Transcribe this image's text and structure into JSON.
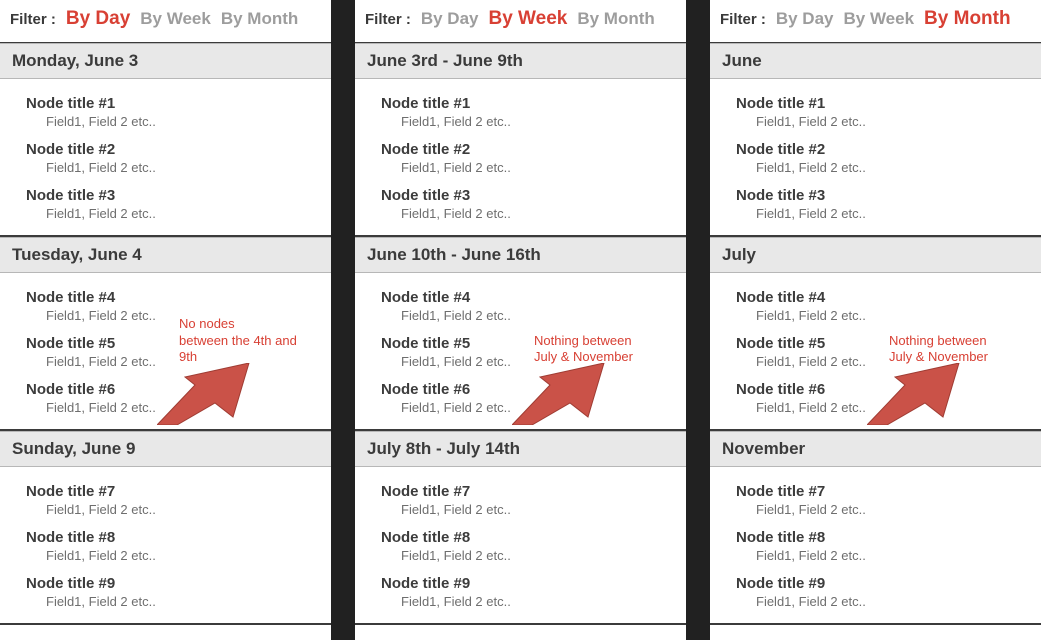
{
  "colors": {
    "accent": "#d84034",
    "header_bg": "#e8e8e8"
  },
  "filter_label": "Filter :",
  "filter_options": [
    "By Day",
    "By Week",
    "By Month"
  ],
  "panels": [
    {
      "active_filter": 0,
      "sections": [
        {
          "header": "Monday, June 3",
          "nodes": [
            {
              "title": "Node title #1",
              "fields": "Field1, Field 2 etc.."
            },
            {
              "title": "Node title #2",
              "fields": "Field1, Field 2 etc.."
            },
            {
              "title": "Node title #3",
              "fields": "Field1, Field 2 etc.."
            }
          ],
          "annotation": null
        },
        {
          "header": "Tuesday, June 4",
          "nodes": [
            {
              "title": "Node title #4",
              "fields": "Field1, Field 2 etc.."
            },
            {
              "title": "Node title #5",
              "fields": "Field1, Field 2 etc.."
            },
            {
              "title": "Node title #6",
              "fields": "Field1, Field 2 etc.."
            }
          ],
          "annotation": "No nodes\nbetween the 4th and 9th"
        },
        {
          "header": "Sunday, June 9",
          "nodes": [
            {
              "title": "Node title #7",
              "fields": "Field1, Field 2 etc.."
            },
            {
              "title": "Node title #8",
              "fields": "Field1, Field 2 etc.."
            },
            {
              "title": "Node title #9",
              "fields": "Field1, Field 2 etc.."
            }
          ],
          "annotation": null
        }
      ]
    },
    {
      "active_filter": 1,
      "sections": [
        {
          "header": "June 3rd - June 9th",
          "nodes": [
            {
              "title": "Node title #1",
              "fields": "Field1, Field 2 etc.."
            },
            {
              "title": "Node title #2",
              "fields": "Field1, Field 2 etc.."
            },
            {
              "title": "Node title #3",
              "fields": "Field1, Field 2 etc.."
            }
          ],
          "annotation": null
        },
        {
          "header": "June 10th - June 16th",
          "nodes": [
            {
              "title": "Node title #4",
              "fields": "Field1, Field 2 etc.."
            },
            {
              "title": "Node title #5",
              "fields": "Field1, Field 2 etc.."
            },
            {
              "title": "Node title #6",
              "fields": "Field1, Field 2 etc.."
            }
          ],
          "annotation": "Nothing between\nJuly & November"
        },
        {
          "header": "July 8th - July 14th",
          "nodes": [
            {
              "title": "Node title #7",
              "fields": "Field1, Field 2 etc.."
            },
            {
              "title": "Node title #8",
              "fields": "Field1, Field 2 etc.."
            },
            {
              "title": "Node title #9",
              "fields": "Field1, Field 2 etc.."
            }
          ],
          "annotation": null
        }
      ]
    },
    {
      "active_filter": 2,
      "sections": [
        {
          "header": "June",
          "nodes": [
            {
              "title": "Node title #1",
              "fields": "Field1, Field 2 etc.."
            },
            {
              "title": "Node title #2",
              "fields": "Field1, Field 2 etc.."
            },
            {
              "title": "Node title #3",
              "fields": "Field1, Field 2 etc.."
            }
          ],
          "annotation": null
        },
        {
          "header": "July",
          "nodes": [
            {
              "title": "Node title #4",
              "fields": "Field1, Field 2 etc.."
            },
            {
              "title": "Node title #5",
              "fields": "Field1, Field 2 etc.."
            },
            {
              "title": "Node title #6",
              "fields": "Field1, Field 2 etc.."
            }
          ],
          "annotation": "Nothing between\nJuly & November"
        },
        {
          "header": "November",
          "nodes": [
            {
              "title": "Node title #7",
              "fields": "Field1, Field 2 etc.."
            },
            {
              "title": "Node title #8",
              "fields": "Field1, Field 2 etc.."
            },
            {
              "title": "Node title #9",
              "fields": "Field1, Field 2 etc.."
            }
          ],
          "annotation": null
        }
      ]
    }
  ]
}
